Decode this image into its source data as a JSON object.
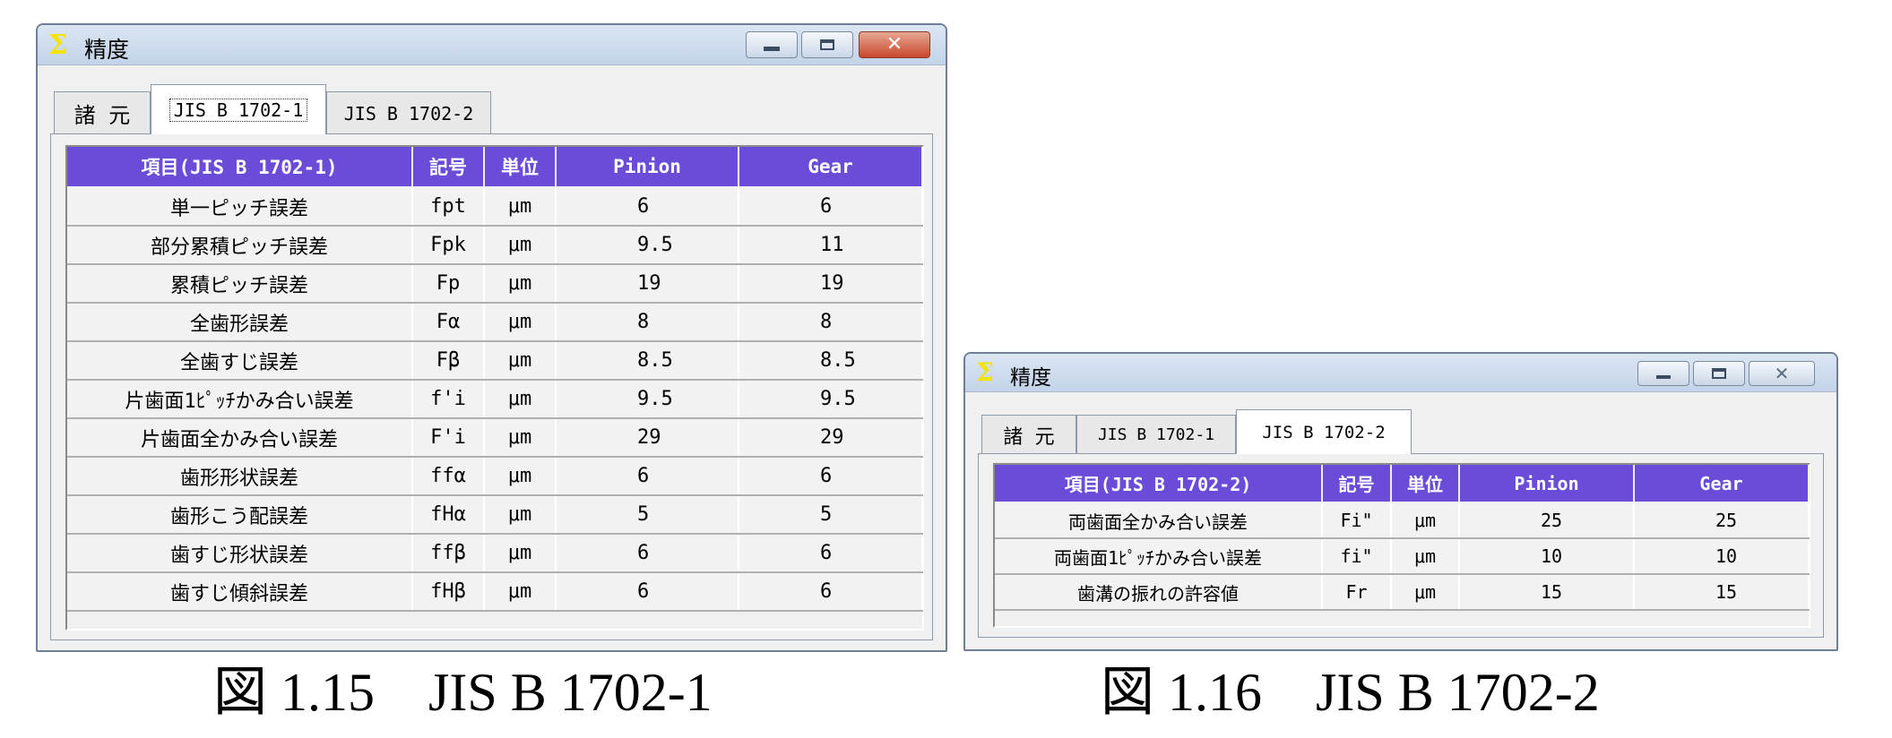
{
  "win1": {
    "title": "精度",
    "title_icon": "sigma-icon",
    "tabs": [
      "諸 元",
      "JIS B 1702-1",
      "JIS B 1702-2"
    ],
    "active_tab": 1,
    "columns": [
      "項目(JIS B 1702-1)",
      "記号",
      "単位",
      "Pinion",
      "Gear"
    ],
    "rows": [
      {
        "item": "単一ピッチ誤差",
        "symbol": "fpt",
        "unit": "μm",
        "pinion": "6",
        "gear": "6"
      },
      {
        "item": "部分累積ピッチ誤差",
        "symbol": "Fpk",
        "unit": "μm",
        "pinion": "9.5",
        "gear": "11"
      },
      {
        "item": "累積ピッチ誤差",
        "symbol": "Fp",
        "unit": "μm",
        "pinion": "19",
        "gear": "19"
      },
      {
        "item": "全歯形誤差",
        "symbol": "Fα",
        "unit": "μm",
        "pinion": "8",
        "gear": "8"
      },
      {
        "item": "全歯すじ誤差",
        "symbol": "Fβ",
        "unit": "μm",
        "pinion": "8.5",
        "gear": "8.5"
      },
      {
        "item": "片歯面1ﾋﾟｯﾁかみ合い誤差",
        "symbol": "f'i",
        "unit": "μm",
        "pinion": "9.5",
        "gear": "9.5"
      },
      {
        "item": "片歯面全かみ合い誤差",
        "symbol": "F'i",
        "unit": "μm",
        "pinion": "29",
        "gear": "29"
      },
      {
        "item": "歯形形状誤差",
        "symbol": "ffα",
        "unit": "μm",
        "pinion": "6",
        "gear": "6"
      },
      {
        "item": "歯形こう配誤差",
        "symbol": "fHα",
        "unit": "μm",
        "pinion": "5",
        "gear": "5"
      },
      {
        "item": "歯すじ形状誤差",
        "symbol": "ffβ",
        "unit": "μm",
        "pinion": "6",
        "gear": "6"
      },
      {
        "item": "歯すじ傾斜誤差",
        "symbol": "fHβ",
        "unit": "μm",
        "pinion": "6",
        "gear": "6"
      }
    ],
    "caption": "図 1.15　JIS B 1702-1"
  },
  "win2": {
    "title": "精度",
    "title_icon": "sigma-icon",
    "tabs": [
      "諸 元",
      "JIS B 1702-1",
      "JIS B 1702-2"
    ],
    "active_tab": 2,
    "columns": [
      "項目(JIS B 1702-2)",
      "記号",
      "単位",
      "Pinion",
      "Gear"
    ],
    "rows": [
      {
        "item": "両歯面全かみ合い誤差",
        "symbol": "Fi\"",
        "unit": "μm",
        "pinion": "25",
        "gear": "25"
      },
      {
        "item": "両歯面1ﾋﾟｯﾁかみ合い誤差",
        "symbol": "fi\"",
        "unit": "μm",
        "pinion": "10",
        "gear": "10"
      },
      {
        "item": "歯溝の振れの許容値",
        "symbol": "Fr",
        "unit": "μm",
        "pinion": "15",
        "gear": "15"
      }
    ],
    "caption": "図 1.16　JIS B 1702-2"
  }
}
